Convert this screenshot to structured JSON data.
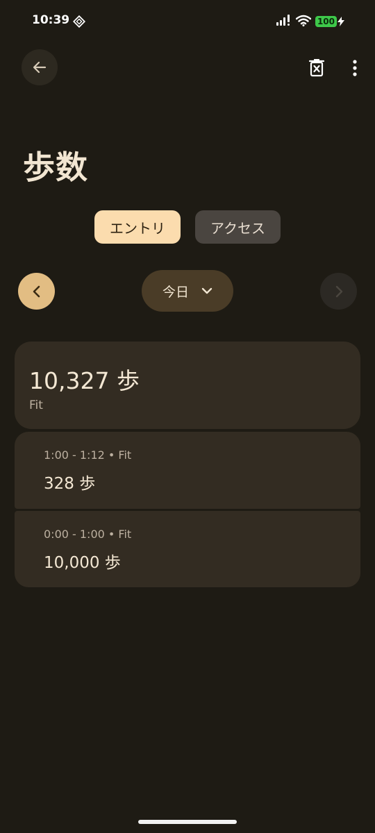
{
  "status_bar": {
    "time": "10:39",
    "battery": "100",
    "battery_color": "#3ec84a"
  },
  "toolbar": {
    "back_icon": "arrow-left-icon",
    "delete_icon": "delete-icon",
    "more_icon": "more-vertical-icon"
  },
  "page": {
    "title": "歩数"
  },
  "tabs": [
    {
      "label": "エントリ",
      "selected": true
    },
    {
      "label": "アクセス",
      "selected": false
    }
  ],
  "date_nav": {
    "label": "今日",
    "prev_icon": "chevron-left-icon",
    "next_icon": "chevron-right-icon",
    "next_enabled": false
  },
  "summary": {
    "value": "10,327 歩",
    "source": "Fit"
  },
  "entries": [
    {
      "meta": "1:00 - 1:12 • Fit",
      "value": "328 歩"
    },
    {
      "meta": "0:00 - 1:00 • Fit",
      "value": "10,000 歩"
    }
  ],
  "colors": {
    "background": "#1e1b14",
    "card": "#332c22",
    "accent": "#fbdcae",
    "accent_dark": "#e2bd83"
  }
}
